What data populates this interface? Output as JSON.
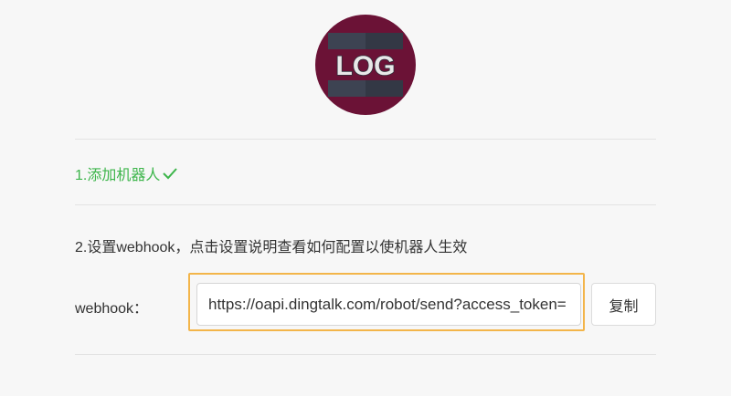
{
  "logo": {
    "text": "LOG",
    "colors": {
      "circle": "#6b1236",
      "bars": "#3d4352",
      "bar_dark": "#2e3340",
      "text": "#e8e8e8",
      "text_stroke": "#2c303b"
    }
  },
  "steps": {
    "step1_label": "1.添加机器人",
    "step1_icon": "checkmark-icon",
    "step2_label": "2.设置webhook，点击设置说明查看如何配置以使机器人生效"
  },
  "webhook": {
    "label": "webhook：",
    "value": "https://oapi.dingtalk.com/robot/send?access_token=",
    "copy_label": "复制"
  },
  "colors": {
    "success": "#3cb54a",
    "highlight": "#f3b54a",
    "background": "#f7f7f7"
  }
}
